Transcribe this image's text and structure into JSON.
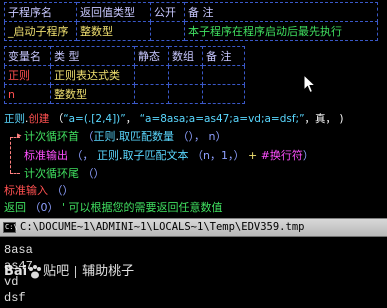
{
  "subroutine_table": {
    "headers": [
      "子程序名",
      "返回值类型",
      "公开",
      "备 注"
    ],
    "row": {
      "name": "_启动子程序",
      "return_type": "整数型",
      "public": "",
      "note": "本子程序在程序启动后最先执行"
    }
  },
  "variable_table": {
    "headers": [
      "变量名",
      "类 型",
      "静态",
      "数组",
      "备 注"
    ],
    "rows": [
      {
        "name": "正则",
        "type": "正则表达式类",
        "static": "",
        "array": "",
        "note": ""
      },
      {
        "name": "n",
        "type": "整数型",
        "static": "",
        "array": "",
        "note": ""
      }
    ]
  },
  "code": {
    "l1_obj": "正则",
    "l1_dot": ".",
    "l1_method": "创建",
    "l1_open": "（",
    "l1_pattern": "“a=(.[2,4])”",
    "l1_comma1": "，",
    "l1_text": "“a=8asa;a=as47;a=vd;a=dsf;”",
    "l1_comma2": "，",
    "l1_bool": "真",
    "l1_comma3": "，",
    "l1_tail": ")",
    "l2_kw": "计次循环首",
    "l2_open": "（",
    "l2_obj": "正则",
    "l2_dot": ".",
    "l2_method": "取匹配数量",
    "l2_args": "（）",
    "l2_comma": "，",
    "l2_var": "n",
    "l2_close": "）",
    "l3_func": "标准输出",
    "l3_open": "（",
    "l3_comma1": "，",
    "l3_obj": "正则",
    "l3_dot": ".",
    "l3_method": "取子匹配文本",
    "l3_args": "（n，1，）",
    "l3_plus": "+",
    "l3_const": "#换行符",
    "l3_close": "）",
    "l4_kw": "计次循环尾",
    "l4_args": "（）",
    "l5_func": "标准输入",
    "l5_args": "（）",
    "l6_kw": "返回",
    "l6_args": "（0）",
    "l6_comment": "' 可以根据您的需要返回任意数值"
  },
  "console": {
    "title": "C:\\DOCUME~1\\ADMINI~1\\LOCALS~1\\Temp\\EDV359.tmp",
    "icon_text": "C:\\",
    "lines": [
      "8asa",
      "as47",
      "vd",
      "dsf"
    ]
  },
  "watermark": {
    "brand": "Bai",
    "brand2": "贴吧",
    "user": "辅助桃子"
  },
  "colors": {
    "keyword": "#40e060",
    "function": "#ff5050",
    "string": "#5ad8ff",
    "table_border": "#3a58c8"
  }
}
